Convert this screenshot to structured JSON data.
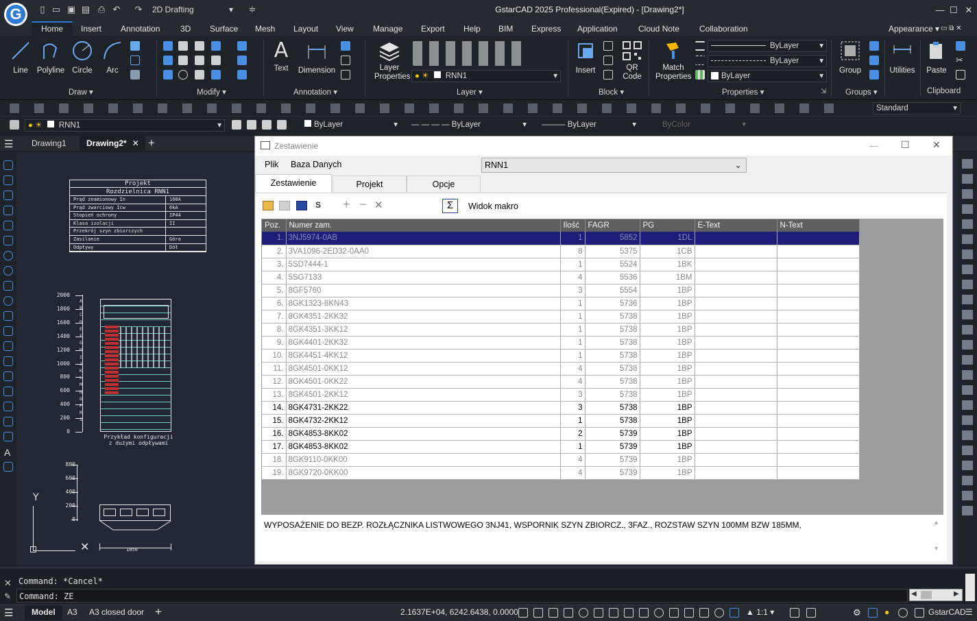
{
  "titlebar": {
    "workspace": "2D Drafting",
    "title": "GstarCAD 2025 Professional(Expired) - [Drawing2*]",
    "appearance": "Appearance"
  },
  "menu_tabs": [
    "Home",
    "Insert",
    "Annotation",
    "3D",
    "Surface",
    "Mesh",
    "Layout",
    "View",
    "Manage",
    "Export",
    "Help",
    "BIM",
    "Express",
    "Application",
    "Cloud Note",
    "Collaboration"
  ],
  "ribbon": {
    "draw": {
      "group": "Draw",
      "line": "Line",
      "polyline": "Polyline",
      "circle": "Circle",
      "arc": "Arc"
    },
    "modify": {
      "group": "Modify"
    },
    "annotation": {
      "group": "Annotation",
      "text": "Text",
      "dimension": "Dimension"
    },
    "layer": {
      "group": "Layer",
      "layer_properties": "Layer Properties",
      "layer_combo": "RNN1"
    },
    "block": {
      "group": "Block",
      "insert": "Insert",
      "qr_code": "QR Code"
    },
    "properties": {
      "group": "Properties",
      "match": "Match Properties",
      "color": "ByLayer",
      "linetype": "ByLayer",
      "lineweight": "ByLayer"
    },
    "groups": {
      "group": "Groups",
      "group_btn": "Group"
    },
    "utilities": {
      "utilities": "Utilities"
    },
    "clipboard": {
      "group": "Clipboard",
      "paste": "Paste"
    }
  },
  "toolbar2": {
    "layer": "RNN1",
    "color": "ByLayer",
    "linetype": "ByLayer",
    "lineweight": "ByLayer",
    "plotstyle": "ByColor",
    "style": "Standard"
  },
  "doc_tabs": [
    "Drawing1",
    "Drawing2*"
  ],
  "drawing": {
    "table_title": "Projekt",
    "table_subtitle": "Rozdzielnica RNN1",
    "rows": [
      {
        "label": "Prąd znamionowy In",
        "value": "160A"
      },
      {
        "label": "Prąd zwarciowy Icw",
        "value": "6kA"
      },
      {
        "label": "Stopień ochrony",
        "value": "IP44"
      },
      {
        "label": "Klasa izolacji",
        "value": "II"
      },
      {
        "label": "Przekrój szyn zbiorczych",
        "value": ""
      },
      {
        "label": "Zasilanie",
        "value": "Góra"
      },
      {
        "label": "Odpływy",
        "value": "Dół"
      }
    ],
    "scale1": [
      "2000",
      "1800",
      "1600",
      "1400",
      "1200",
      "1000",
      "800",
      "600",
      "400",
      "200",
      "0"
    ],
    "letters": [
      "A",
      "B",
      "C",
      "D",
      "E",
      "F",
      "G",
      "H",
      "I",
      "J",
      "K",
      "L",
      "M",
      "N",
      "O",
      "P",
      "R",
      "S"
    ],
    "caption1": "Przykład konfiguracji",
    "caption2": "z dużymi odpływami",
    "scale2": [
      "800",
      "600",
      "400",
      "200",
      "0"
    ],
    "dim": "1050",
    "axis_y": "Y"
  },
  "dialog": {
    "title": "Zestawienie",
    "menu_file": "Plik",
    "menu_db": "Baza Danych",
    "combo": "RNN1",
    "tabs": [
      "Zestawienie",
      "Projekt",
      "Opcje"
    ],
    "toolbar_s": "S",
    "macro_label": "Widok makro",
    "columns": [
      "Poz.",
      "Numer zam.",
      "Ilość",
      "FAGR",
      "PG",
      "E-Text",
      "N-Text"
    ],
    "rows": [
      {
        "poz": "1.",
        "nr": "3NJ5974-0AB",
        "ilosc": "1",
        "fagr": "5852",
        "pg": "1DL",
        "e": "",
        "n": ""
      },
      {
        "poz": "2.",
        "nr": "3VA1096-2ED32-0AA0",
        "ilosc": "8",
        "fagr": "5375",
        "pg": "1CB",
        "e": "",
        "n": ""
      },
      {
        "poz": "3.",
        "nr": "5SD7444-1",
        "ilosc": "1",
        "fagr": "5524",
        "pg": "1BK",
        "e": "",
        "n": ""
      },
      {
        "poz": "4.",
        "nr": "5SG7133",
        "ilosc": "4",
        "fagr": "5536",
        "pg": "1BM",
        "e": "",
        "n": ""
      },
      {
        "poz": "5.",
        "nr": "8GF5760",
        "ilosc": "3",
        "fagr": "5554",
        "pg": "1BP",
        "e": "",
        "n": ""
      },
      {
        "poz": "6.",
        "nr": "8GK1323-8KN43",
        "ilosc": "1",
        "fagr": "5736",
        "pg": "1BP",
        "e": "",
        "n": ""
      },
      {
        "poz": "7.",
        "nr": "8GK4351-2KK32",
        "ilosc": "1",
        "fagr": "5738",
        "pg": "1BP",
        "e": "",
        "n": ""
      },
      {
        "poz": "8.",
        "nr": "8GK4351-3KK12",
        "ilosc": "1",
        "fagr": "5738",
        "pg": "1BP",
        "e": "",
        "n": ""
      },
      {
        "poz": "9.",
        "nr": "8GK4401-2KK32",
        "ilosc": "1",
        "fagr": "5738",
        "pg": "1BP",
        "e": "",
        "n": ""
      },
      {
        "poz": "10.",
        "nr": "8GK4451-4KK12",
        "ilosc": "1",
        "fagr": "5738",
        "pg": "1BP",
        "e": "",
        "n": ""
      },
      {
        "poz": "11.",
        "nr": "8GK4501-0KK12",
        "ilosc": "4",
        "fagr": "5738",
        "pg": "1BP",
        "e": "",
        "n": ""
      },
      {
        "poz": "12.",
        "nr": "8GK4501-0KK22",
        "ilosc": "4",
        "fagr": "5738",
        "pg": "1BP",
        "e": "",
        "n": ""
      },
      {
        "poz": "13.",
        "nr": "8GK4501-2KK12",
        "ilosc": "3",
        "fagr": "5738",
        "pg": "1BP",
        "e": "",
        "n": ""
      },
      {
        "poz": "14.",
        "nr": "8GK4731-2KK22",
        "ilosc": "3",
        "fagr": "5738",
        "pg": "1BP",
        "e": "",
        "n": "",
        "dark": true
      },
      {
        "poz": "15.",
        "nr": "8GK4732-2KK12",
        "ilosc": "1",
        "fagr": "5738",
        "pg": "1BP",
        "e": "",
        "n": "",
        "dark": true
      },
      {
        "poz": "16.",
        "nr": "8GK4853-8KK02",
        "ilosc": "2",
        "fagr": "5739",
        "pg": "1BP",
        "e": "",
        "n": "",
        "dark": true
      },
      {
        "poz": "17.",
        "nr": "8GK4853-8KK02",
        "ilosc": "1",
        "fagr": "5739",
        "pg": "1BP",
        "e": "",
        "n": "",
        "dark": true
      },
      {
        "poz": "18.",
        "nr": "8GK9110-0KK00",
        "ilosc": "4",
        "fagr": "5739",
        "pg": "1BP",
        "e": "",
        "n": ""
      },
      {
        "poz": "19.",
        "nr": "8GK9720-0KK00",
        "ilosc": "4",
        "fagr": "5739",
        "pg": "1BP",
        "e": "",
        "n": ""
      }
    ],
    "description": "WYPOSAŻENIE DO BEZP. ROZŁĄCZNIKA LISTWOWEGO 3NJ41, WSPORNIK SZYN ZBIORCZ., 3FAZ., ROZSTAW SZYN 100MM BZW 185MM,"
  },
  "command": {
    "line1": "Command: *Cancel*",
    "line2": "Command: ZE"
  },
  "status": {
    "model": "Model",
    "tab_a3": "A3",
    "tab_a3door": "A3 closed door",
    "coords": "2.1637E+04, 6242.6438, 0.0000",
    "scale": "1:1",
    "brand": "GstarCAD"
  },
  "colors": {
    "accent": "#2b7bd6",
    "selection": "#1e1e7a"
  }
}
